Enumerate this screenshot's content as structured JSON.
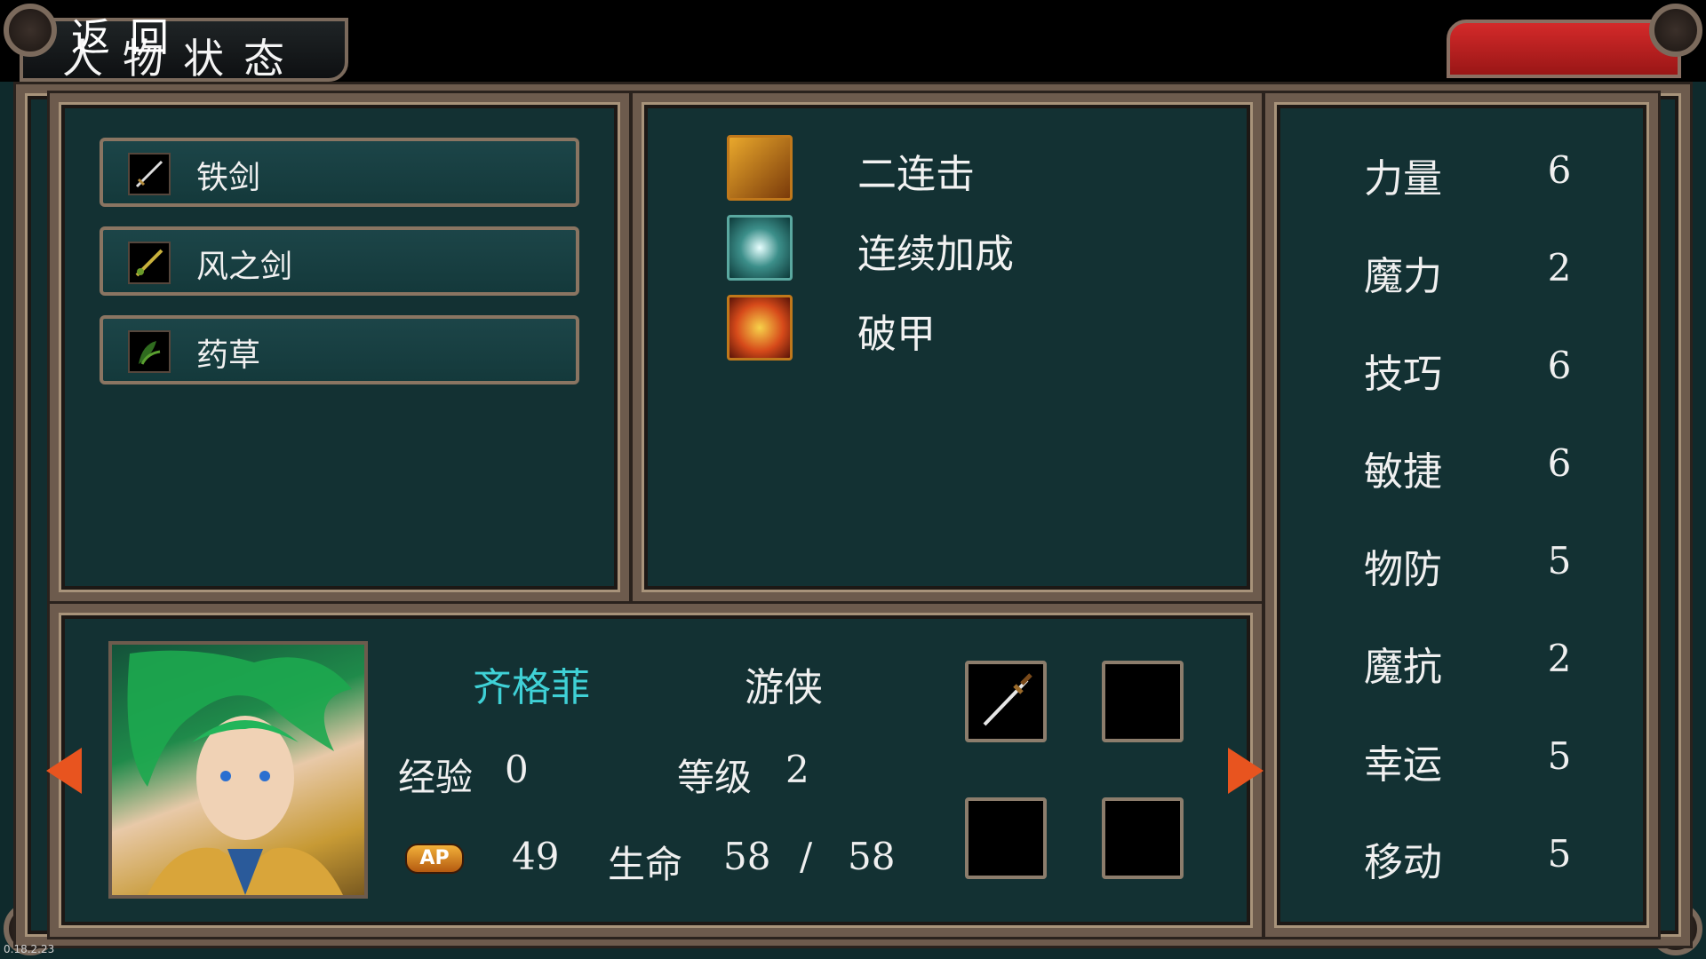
{
  "header": {
    "title": "人物状态",
    "back_label": "返回"
  },
  "items": [
    {
      "label": "铁剑",
      "icon": "iron-sword-icon"
    },
    {
      "label": "风之剑",
      "icon": "wind-sword-icon"
    },
    {
      "label": "药草",
      "icon": "herb-icon"
    }
  ],
  "skills": [
    {
      "label": "二连击",
      "icon": "double-strike-icon",
      "color": "#d88a1c"
    },
    {
      "label": "连续加成",
      "icon": "combo-bonus-icon",
      "color": "#3c8f8a"
    },
    {
      "label": "破甲",
      "icon": "armor-break-icon",
      "color": "#d64a1a"
    }
  ],
  "stats": [
    {
      "name": "力量",
      "value": "6"
    },
    {
      "name": "魔力",
      "value": "2"
    },
    {
      "name": "技巧",
      "value": "6"
    },
    {
      "name": "敏捷",
      "value": "6"
    },
    {
      "name": "物防",
      "value": "5"
    },
    {
      "name": "魔抗",
      "value": "2"
    },
    {
      "name": "幸运",
      "value": "5"
    },
    {
      "name": "移动",
      "value": "5"
    }
  ],
  "character": {
    "name": "齐格菲",
    "class": "游侠",
    "exp_label": "经验",
    "exp_value": "0",
    "level_label": "等级",
    "level_value": "2",
    "ap_badge": "AP",
    "ap_value": "49",
    "hp_label": "生命",
    "hp_current": "58",
    "hp_sep": "/",
    "hp_max": "58",
    "name_color": "#3fd1d6"
  },
  "version": "0.18.2.23"
}
